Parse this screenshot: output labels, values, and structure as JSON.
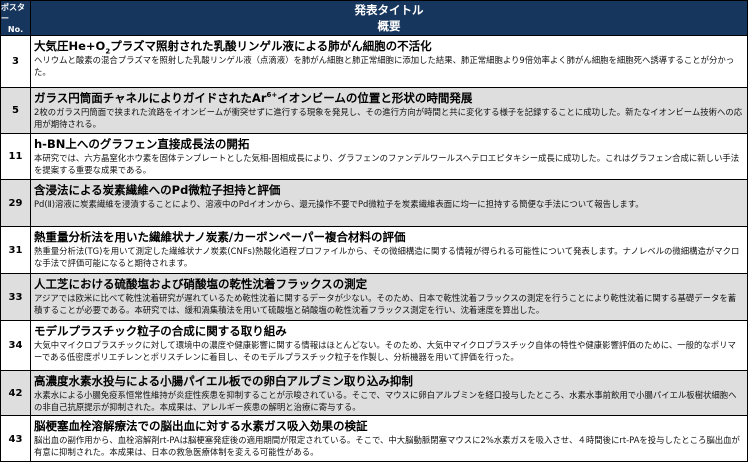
{
  "header": {
    "num_line1": "ポスター",
    "num_line2": "No.",
    "title_line1": "発表タイトル",
    "title_line2": "概要"
  },
  "rows": [
    {
      "num": "3",
      "title_a": "大気圧He+O",
      "title_sub": "2",
      "title_b": "プラズマ照射された乳酸リンゲル液による肺がん細胞の不活化",
      "desc": "ヘリウムと酸素の混合プラズマを照射した乳酸リンゲル液（点滴液）を肺がん細胞と肺正常細胞に添加した結果、肺正常細胞より9倍効率よく肺がん細胞を細胞死へ誘導することが分かった。"
    },
    {
      "num": "5",
      "title_a": "ガラス円筒面チャネルによりガイドされたAr",
      "title_sup": "6+",
      "title_b": "イオンビームの位置と形状の時間発展",
      "desc": "2枚のガラス円筒面で挟まれた流路をイオンビームが衝突せずに進行する現象を発見し、その進行方向が時間と共に変化する様子を記録することに成功した。新たなイオンビーム技術への応用が期待される。"
    },
    {
      "num": "11",
      "title_a": "h-BN上へのグラフェン直接成長法の開拓",
      "desc": "本研究では、六方晶窒化ホウ素を固体テンプレートとした気相-固相成長により、グラフェンのファンデルワールスヘテロエピタキシー成長に成功した。これはグラフェン合成に新しい手法を提案する重要な成果である。"
    },
    {
      "num": "29",
      "title_a": "含浸法による炭素繊維へのPd微粒子担持と評価",
      "desc": "Pd(Ⅱ)溶液に炭素繊維を浸漬することにより、溶液中のPdイオンから、還元操作不要でPd微粒子を炭素繊維表面に均一に担持する簡便な手法について報告します。"
    },
    {
      "num": "31",
      "title_a": "熱重量分析法を用いた繊維状ナノ炭素/カーボンペーパー複合材料の評価",
      "desc": "熱重量分析法(TG)を用いて測定した繊維状ナノ炭素(CNFs)熱酸化過程プロファイルから、その微細構造に関する情報が得られる可能性について発表します。ナノレベルの微細構造がマクロな手法で評価可能になると期待されます。"
    },
    {
      "num": "33",
      "title_a": "人工芝における硫酸塩および硝酸塩の乾性沈着フラックスの測定",
      "desc": "アジアでは欧米に比べて乾性沈着研究が遅れているため乾性沈着に関するデータが少ない。そのため、日本で乾性沈着フラックスの測定を行うことにより乾性沈着に関する基礎データを蓄積することが必要である。本研究では、緩和渦集積法を用いて硫酸塩と硝酸塩の乾性沈着フラックス測定を行い、沈着速度を算出した。"
    },
    {
      "num": "34",
      "title_a": "モデルプラスチック粒子の合成に関する取り組み",
      "desc": "大気中マイクロプラスチックに対して環境中の濃度や健康影響に関する情報はほとんどない。そのため、大気中マイクロプラスチック自体の特性や健康影響評価のために、一般的なポリマーである低密度ポリエチレンとポリスチレンに着目し、そのモデルプラスチック粒子を作製し、分析機器を用いて評価を行った。"
    },
    {
      "num": "42",
      "title_a": "高濃度水素水投与による小腸パイエル板での卵白アルブミン取り込み抑制",
      "desc": "水素水による小腸免疫系恒常性維持が炎症性疾患を抑制することが示唆されている。そこで、マウスに卵白アルブミンを経口投与したところ、水素水事前飲用で小腸パイエル板樹状細胞への非自己抗原提示が抑制された。本成果は、アレルギー疾患の解明と治療に寄与する。"
    },
    {
      "num": "43",
      "title_a": "脳梗塞血栓溶解療法での脳出血に対する水素ガス吸入効果の検証",
      "desc": "脳出血の副作用から、血栓溶解剤rt-PAは脳梗塞発症後の適用期間が限定されている。そこで、中大脳動脈閉塞マウスに2%水素ガスを吸入させ、４時間後にrt-PAを投与したところ脳出血が有意に抑制された。本成果は、日本の救急医療体制を変える可能性がある。"
    }
  ]
}
